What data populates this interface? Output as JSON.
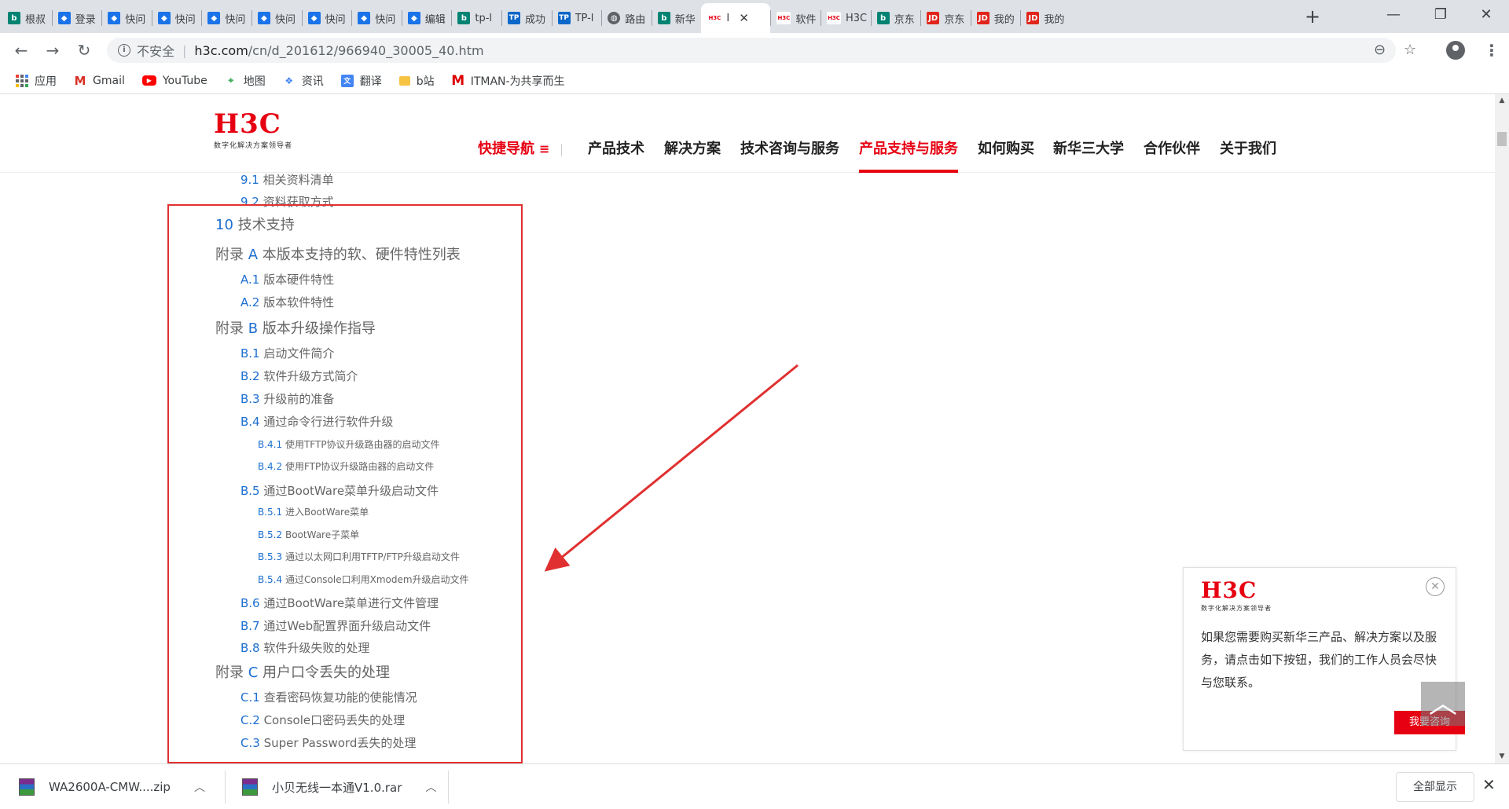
{
  "tabs": [
    {
      "icon": "bing",
      "title": "根叔"
    },
    {
      "icon": "doc",
      "title": "登录"
    },
    {
      "icon": "doc",
      "title": "快问"
    },
    {
      "icon": "doc",
      "title": "快问"
    },
    {
      "icon": "doc",
      "title": "快问"
    },
    {
      "icon": "doc",
      "title": "快问"
    },
    {
      "icon": "doc",
      "title": "快问"
    },
    {
      "icon": "doc",
      "title": "快问"
    },
    {
      "icon": "doc",
      "title": "编辑"
    },
    {
      "icon": "bing",
      "title": "tp-l"
    },
    {
      "icon": "tp",
      "title": "成功"
    },
    {
      "icon": "tp",
      "title": "TP-l"
    },
    {
      "icon": "globe",
      "title": "路由"
    },
    {
      "icon": "bing",
      "title": "新华"
    },
    {
      "icon": "h3c",
      "title": "I",
      "active": true
    },
    {
      "icon": "h3c",
      "title": "软件"
    },
    {
      "icon": "h3c",
      "title": "H3C"
    },
    {
      "icon": "bing",
      "title": "京东"
    },
    {
      "icon": "jd",
      "title": "京东"
    },
    {
      "icon": "jd",
      "title": "我的"
    },
    {
      "icon": "jd",
      "title": "我的"
    }
  ],
  "favicon_text": {
    "bing": "b",
    "doc": "◆",
    "tp": "TP",
    "globe": "◍",
    "h3c": "H3C",
    "jd": "JD"
  },
  "tabstrip": {
    "new_tab": "+",
    "close_tab": "✕"
  },
  "window": {
    "minimize": "—",
    "restore": "❐",
    "close": "✕"
  },
  "toolbar": {
    "back": "←",
    "forward": "→",
    "reload": "↻",
    "security_label": "不安全",
    "url_host": "h3c.com",
    "url_path": "/cn/d_201612/966940_30005_40.htm",
    "zoom_icon": "⊖",
    "star_icon": "☆",
    "menu": "⋮"
  },
  "bookmarks": [
    {
      "icon": "apps",
      "label": "应用"
    },
    {
      "icon": "gmail",
      "label": "Gmail"
    },
    {
      "icon": "youtube",
      "label": "YouTube"
    },
    {
      "icon": "maps",
      "label": "地图"
    },
    {
      "icon": "news",
      "label": "资讯"
    },
    {
      "icon": "translate",
      "label": "翻译"
    },
    {
      "icon": "folder",
      "label": "b站"
    },
    {
      "icon": "itman",
      "label": "ITMAN-为共享而生"
    }
  ],
  "site": {
    "logo_text": "H3C",
    "logo_tagline": "数字化解决方案领导者",
    "nav": [
      {
        "label": "快捷导航",
        "style": "hl"
      },
      {
        "label": "产品技术"
      },
      {
        "label": "解决方案"
      },
      {
        "label": "技术咨询与服务"
      },
      {
        "label": "产品支持与服务",
        "style": "current"
      },
      {
        "label": "如何购买"
      },
      {
        "label": "新华三大学"
      },
      {
        "label": "合作伙伴"
      },
      {
        "label": "关于我们"
      }
    ],
    "nav_menu_glyph": "≡"
  },
  "toc": [
    {
      "level": 2,
      "num": "9.1",
      "title": "相关资料清单"
    },
    {
      "level": 2,
      "num": "9.2",
      "title": "资料获取方式"
    },
    {
      "level": 1,
      "num": "10",
      "title": "技术支持"
    },
    {
      "level": 1,
      "prefix": "附录",
      "num": "A",
      "title": "本版本支持的软、硬件特性列表"
    },
    {
      "level": 2,
      "num": "A.1",
      "title": "版本硬件特性"
    },
    {
      "level": 2,
      "num": "A.2",
      "title": "版本软件特性"
    },
    {
      "level": 1,
      "prefix": "附录",
      "num": "B",
      "title": "版本升级操作指导"
    },
    {
      "level": 2,
      "num": "B.1",
      "title": "启动文件简介"
    },
    {
      "level": 2,
      "num": "B.2",
      "title": "软件升级方式简介"
    },
    {
      "level": 2,
      "num": "B.3",
      "title": "升级前的准备"
    },
    {
      "level": 2,
      "num": "B.4",
      "title": "通过命令行进行软件升级"
    },
    {
      "level": 3,
      "num": "B.4.1",
      "title": "使用TFTP协议升级路由器的启动文件"
    },
    {
      "level": 3,
      "num": "B.4.2",
      "title": "使用FTP协议升级路由器的启动文件"
    },
    {
      "level": 2,
      "num": "B.5",
      "title": "通过BootWare菜单升级启动文件"
    },
    {
      "level": 3,
      "num": "B.5.1",
      "title": "进入BootWare菜单"
    },
    {
      "level": 3,
      "num": "B.5.2",
      "title": "BootWare子菜单"
    },
    {
      "level": 3,
      "num": "B.5.3",
      "title": "通过以太网口利用TFTP/FTP升级启动文件"
    },
    {
      "level": 3,
      "num": "B.5.4",
      "title": "通过Console口利用Xmodem升级启动文件"
    },
    {
      "level": 2,
      "num": "B.6",
      "title": "通过BootWare菜单进行文件管理"
    },
    {
      "level": 2,
      "num": "B.7",
      "title": "通过Web配置界面升级启动文件"
    },
    {
      "level": 2,
      "num": "B.8",
      "title": "软件升级失败的处理"
    },
    {
      "level": 1,
      "prefix": "附录",
      "num": "C",
      "title": "用户口令丢失的处理"
    },
    {
      "level": 2,
      "num": "C.1",
      "title": "查看密码恢复功能的使能情况"
    },
    {
      "level": 2,
      "num": "C.2",
      "title": "Console口密码丢失的处理"
    },
    {
      "level": 2,
      "num": "C.3",
      "title": "Super Password丢失的处理"
    }
  ],
  "consult_popup": {
    "logo_text": "H3C",
    "logo_tagline": "数字化解决方案领导者",
    "message": "如果您需要购买新华三产品、解决方案以及服务，请点击如下按钮，我们的工作人员会尽快与您联系。",
    "button": "我要咨询",
    "close_icon": "✕"
  },
  "back_to_top": "︿",
  "downloads": [
    {
      "filename": "WA2600A-CMW....zip"
    },
    {
      "filename": "小贝无线一本通V1.0.rar"
    }
  ],
  "download_shelf": {
    "show_all": "全部显示",
    "close": "✕",
    "chevron": "︿"
  },
  "scrollbar": {
    "up": "▲",
    "down": "▼"
  },
  "colors": {
    "brand_red": "#e60012",
    "link_blue": "#1d6fd0",
    "annotation_red": "#e03030"
  }
}
